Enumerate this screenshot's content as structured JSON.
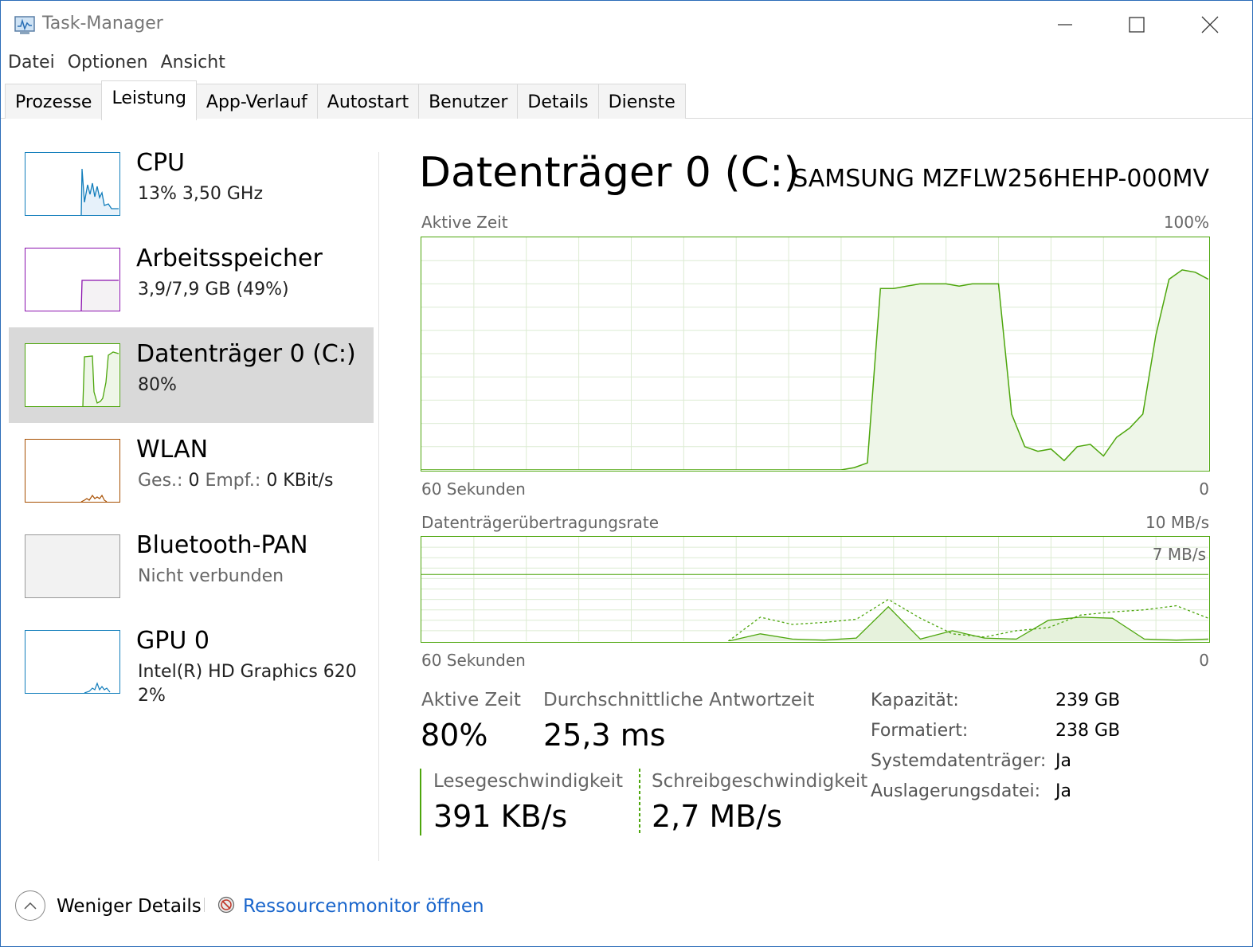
{
  "window": {
    "title": "Task-Manager"
  },
  "menu": [
    "Datei",
    "Optionen",
    "Ansicht"
  ],
  "tabs": [
    "Prozesse",
    "Leistung",
    "App-Verlauf",
    "Autostart",
    "Benutzer",
    "Details",
    "Dienste"
  ],
  "active_tab": "Leistung",
  "sidebar": [
    {
      "name": "CPU",
      "sub": "13%  3,50 GHz",
      "color": "#117dbb"
    },
    {
      "name": "Arbeitsspeicher",
      "sub": "3,9/7,9 GB (49%)",
      "color": "#8b12ae"
    },
    {
      "name": "Datenträger 0 (C:)",
      "sub": "80%",
      "color": "#4da60c"
    },
    {
      "name": "WLAN",
      "sub_label_send": "Ges.:",
      "sub_val_send": "0",
      "sub_label_recv": "Empf.:",
      "sub_val_recv": "0 KBit/s",
      "color": "#a74f01"
    },
    {
      "name": "Bluetooth-PAN",
      "sub": "Nicht verbunden",
      "color": "#999999"
    },
    {
      "name": "GPU 0",
      "sub": "Intel(R) HD Graphics 620",
      "sub2": "2%",
      "color": "#117dbb"
    }
  ],
  "main": {
    "title": "Datenträger 0 (C:)",
    "model": "SAMSUNG MZFLW256HEHP-000MV",
    "chart1": {
      "label_left": "Aktive Zeit",
      "label_right": "100%",
      "bottom_left": "60 Sekunden",
      "bottom_right": "0"
    },
    "chart2": {
      "label_left": "Datenträgerübertragungsrate",
      "label_right": "10 MB/s",
      "inner_label": "7 MB/s",
      "bottom_left": "60 Sekunden",
      "bottom_right": "0"
    },
    "stats": {
      "active_label": "Aktive Zeit",
      "active_value": "80%",
      "resp_label": "Durchschnittliche Antwortzeit",
      "resp_value": "25,3 ms",
      "read_label": "Lesegeschwindigkeit",
      "read_value": "391 KB/s",
      "write_label": "Schreibgeschwindigkeit",
      "write_value": "2,7 MB/s"
    },
    "properties": [
      {
        "key": "Kapazität:",
        "value": "239 GB"
      },
      {
        "key": "Formatiert:",
        "value": "238 GB"
      },
      {
        "key": "Systemdatenträger:",
        "value": "Ja"
      },
      {
        "key": "Auslagerungsdatei:",
        "value": "Ja"
      }
    ]
  },
  "footer": {
    "less_details": "Weniger Details",
    "resource_monitor": "Ressourcenmonitor öffnen"
  },
  "chart_data": [
    {
      "type": "area",
      "title": "Aktive Zeit",
      "x": [
        60,
        55,
        50,
        45,
        40,
        35,
        30,
        29,
        28,
        27,
        26,
        25,
        24,
        23,
        22,
        21,
        20,
        19,
        18,
        17,
        16,
        15,
        14,
        13,
        12,
        11,
        10,
        9,
        8,
        7,
        6,
        5,
        4,
        3,
        2,
        1,
        0
      ],
      "series": [
        {
          "values": [
            0,
            0,
            0,
            0,
            0,
            0,
            0,
            0,
            0,
            1,
            3,
            78,
            78,
            79,
            80,
            80,
            80,
            79,
            80,
            80,
            80,
            24,
            10,
            8,
            9,
            4,
            10,
            11,
            6,
            14,
            18,
            24,
            58,
            82,
            86,
            85,
            82
          ]
        }
      ],
      "ylim": [
        0,
        100
      ],
      "grid": true
    },
    {
      "type": "line",
      "title": "Datenträgerübertragungsrate",
      "x": [
        15,
        14,
        13,
        12,
        11,
        10,
        9,
        8,
        7,
        6,
        5,
        4,
        3,
        2,
        1,
        0
      ],
      "series": [
        {
          "style": "solid",
          "values": [
            0,
            0.7,
            0.2,
            0.1,
            0.3,
            3.3,
            0.2,
            1.0,
            0.3,
            0.2,
            2.0,
            2.3,
            2.2,
            0.2,
            0.1,
            0.2
          ]
        },
        {
          "style": "dashed",
          "values": [
            0,
            2.3,
            1.6,
            1.8,
            2.1,
            4.0,
            2.2,
            0.7,
            0.4,
            1.0,
            1.3,
            2.5,
            2.8,
            3.0,
            3.4,
            2.2
          ]
        }
      ],
      "ylim": [
        0,
        10
      ],
      "grid": true
    }
  ]
}
